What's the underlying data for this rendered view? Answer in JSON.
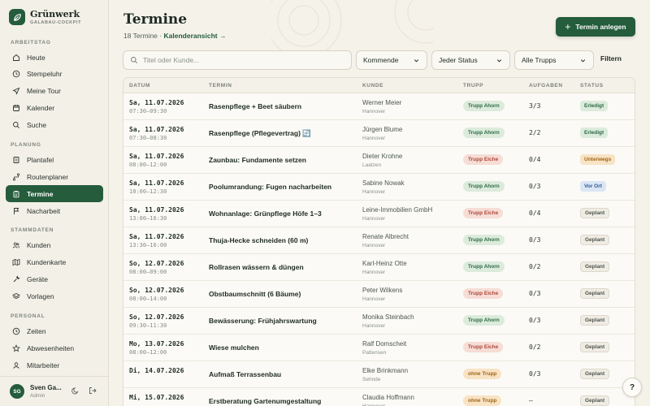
{
  "brand": {
    "name": "Grünwerk",
    "subtitle": "GALABAU-COCKPIT"
  },
  "sidebar": {
    "sections": [
      {
        "label": "ARBEITSTAG",
        "items": [
          {
            "label": "Heute",
            "icon": "home-icon"
          },
          {
            "label": "Stempeluhr",
            "icon": "clock-icon"
          },
          {
            "label": "Meine Tour",
            "icon": "navigation-icon"
          },
          {
            "label": "Kalender",
            "icon": "calendar-icon"
          },
          {
            "label": "Suche",
            "icon": "search-icon"
          }
        ]
      },
      {
        "label": "PLANUNG",
        "items": [
          {
            "label": "Plantafel",
            "icon": "board-icon"
          },
          {
            "label": "Routenplaner",
            "icon": "route-icon"
          },
          {
            "label": "Termine",
            "icon": "clipboard-icon",
            "active": true
          },
          {
            "label": "Nacharbeit",
            "icon": "flag-icon"
          }
        ]
      },
      {
        "label": "STAMMDATEN",
        "items": [
          {
            "label": "Kunden",
            "icon": "users-icon"
          },
          {
            "label": "Kundenkarte",
            "icon": "map-icon"
          },
          {
            "label": "Geräte",
            "icon": "tool-icon"
          },
          {
            "label": "Vorlagen",
            "icon": "layers-icon"
          }
        ]
      },
      {
        "label": "PERSONAL",
        "items": [
          {
            "label": "Zeiten",
            "icon": "clock-icon"
          },
          {
            "label": "Abwesenheiten",
            "icon": "star-icon"
          },
          {
            "label": "Mitarbeiter",
            "icon": "user-icon"
          }
        ]
      }
    ]
  },
  "user": {
    "initials": "SG",
    "name": "Sven Ga...",
    "role": "Admin"
  },
  "header": {
    "title": "Termine",
    "count_text": "18 Termine",
    "separator": "·",
    "link_text": "Kalenderansicht →",
    "new_button": "Termin anlegen"
  },
  "filters": {
    "search_placeholder": "Titel oder Kunde...",
    "time_filter": "Kommende",
    "status_filter": "Jeder Status",
    "trupp_filter": "Alle Trupps",
    "filter_button": "Filtern"
  },
  "table": {
    "headers": {
      "date": "DATUM",
      "title": "TERMIN",
      "customer": "KUNDE",
      "trupp": "TRUPP",
      "tasks": "AUFGABEN",
      "status": "STATUS"
    },
    "rows": [
      {
        "date": "Sa, 11.07.2026",
        "time": "07:30–09:30",
        "title": "Rasenpflege + Beet säubern",
        "customer": "Werner Meier",
        "city": "Hannover",
        "trupp": "Trupp Ahorn",
        "tasks": "3/3",
        "status": "Erledigt"
      },
      {
        "date": "Sa, 11.07.2026",
        "time": "07:30–08:30",
        "title": "Rasenpflege (Pflegevertrag) 🔄",
        "customer": "Jürgen Blume",
        "city": "Hannover",
        "trupp": "Trupp Ahorn",
        "tasks": "2/2",
        "status": "Erledigt"
      },
      {
        "date": "Sa, 11.07.2026",
        "time": "08:00–12:00",
        "title": "Zaunbau: Fundamente setzen",
        "customer": "Dieter Krohne",
        "city": "Laatzen",
        "trupp": "Trupp Eiche",
        "tasks": "0/4",
        "status": "Unterwegs"
      },
      {
        "date": "Sa, 11.07.2026",
        "time": "10:00–12:30",
        "title": "Poolumrandung: Fugen nacharbeiten",
        "customer": "Sabine Nowak",
        "city": "Hannover",
        "trupp": "Trupp Ahorn",
        "tasks": "0/3",
        "status": "Vor Ort"
      },
      {
        "date": "Sa, 11.07.2026",
        "time": "13:00–16:30",
        "title": "Wohnanlage: Grünpflege Höfe 1–3",
        "customer": "Leine-Immobilien GmbH",
        "city": "Hannover",
        "trupp": "Trupp Eiche",
        "tasks": "0/4",
        "status": "Geplant"
      },
      {
        "date": "Sa, 11.07.2026",
        "time": "13:30–16:00",
        "title": "Thuja-Hecke schneiden (60 m)",
        "customer": "Renate Albrecht",
        "city": "Hannover",
        "trupp": "Trupp Ahorn",
        "tasks": "0/3",
        "status": "Geplant"
      },
      {
        "date": "So, 12.07.2026",
        "time": "08:00–09:00",
        "title": "Rollrasen wässern & düngen",
        "customer": "Karl-Heinz Otte",
        "city": "Hannover",
        "trupp": "Trupp Ahorn",
        "tasks": "0/2",
        "status": "Geplant"
      },
      {
        "date": "So, 12.07.2026",
        "time": "08:00–14:00",
        "title": "Obstbaumschnitt (6 Bäume)",
        "customer": "Peter Wilkens",
        "city": "Hannover",
        "trupp": "Trupp Eiche",
        "tasks": "0/3",
        "status": "Geplant"
      },
      {
        "date": "So, 12.07.2026",
        "time": "09:30–11:30",
        "title": "Bewässerung: Frühjahrswartung",
        "customer": "Monika Steinbach",
        "city": "Hannover",
        "trupp": "Trupp Ahorn",
        "tasks": "0/3",
        "status": "Geplant"
      },
      {
        "date": "Mo, 13.07.2026",
        "time": "08:00–12:00",
        "title": "Wiese mulchen",
        "customer": "Ralf Domscheit",
        "city": "Pattensen",
        "trupp": "Trupp Eiche",
        "tasks": "0/2",
        "status": "Geplant"
      },
      {
        "date": "Di, 14.07.2026",
        "time": "",
        "title": "Aufmaß Terrassenbau",
        "customer": "Elke Brinkmann",
        "city": "Sehnde",
        "trupp": "ohne Trupp",
        "tasks": "0/3",
        "status": "Geplant"
      },
      {
        "date": "Mi, 15.07.2026",
        "time": "",
        "title": "Erstberatung Gartenumgestaltung",
        "customer": "Claudia Hoffmann",
        "city": "Hannover",
        "trupp": "ohne Trupp",
        "tasks": "–",
        "status": "Geplant"
      }
    ]
  },
  "help_label": "?",
  "colors": {
    "primary": "#245c3c",
    "background": "#f5f2ea",
    "trupp_ahorn": "#dcebdc",
    "trupp_eiche": "#f6ddd6",
    "ohne_trupp": "#f8e3c4",
    "status_erledigt": "#dcebdc",
    "status_unterwegs": "#f8e3c4",
    "status_vor_ort": "#dbe6f4",
    "status_geplant": "#efece4"
  }
}
